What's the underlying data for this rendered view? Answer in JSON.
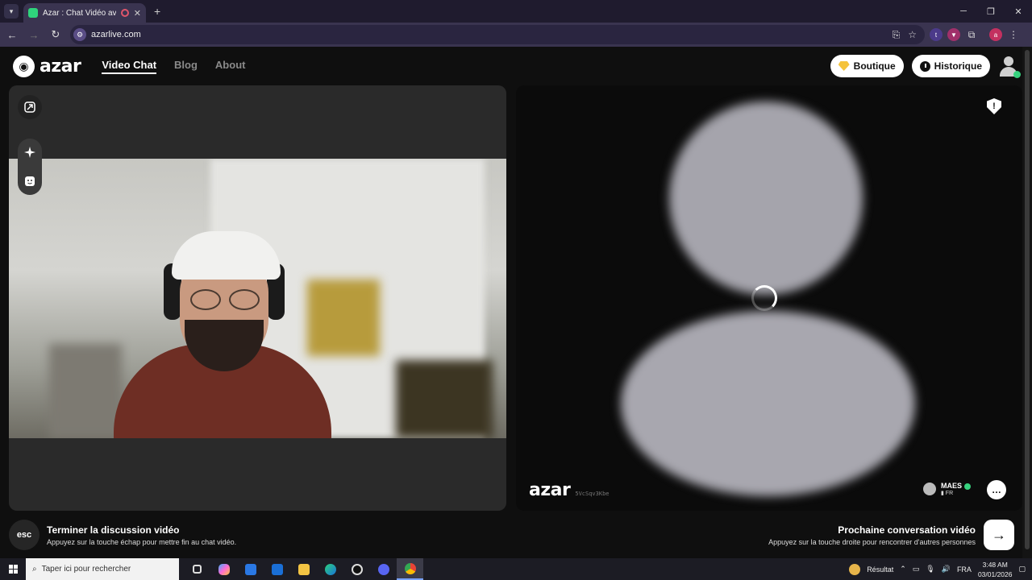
{
  "browser": {
    "tab_title": "Azar : Chat Vidéo avec de n",
    "url": "azarlive.com"
  },
  "nav": {
    "logo_text": "azar",
    "links": [
      "Video Chat",
      "Blog",
      "About"
    ],
    "boutique": "Boutique",
    "historique": "Historique"
  },
  "remote": {
    "watermark": "azar",
    "code": "5VcSqv3Kbe",
    "peer_name": "MAES",
    "peer_country": "FR"
  },
  "bottom": {
    "esc_label": "esc",
    "end_title": "Terminer la discussion vidéo",
    "end_sub": "Appuyez sur la touche échap pour mettre fin au chat vidéo.",
    "next_title": "Prochaine conversation vidéo",
    "next_sub": "Appuyez sur la touche droite pour rencontrer d'autres personnes"
  },
  "taskbar": {
    "search_placeholder": "Taper ici pour rechercher",
    "weather": "Résultat",
    "lang": "FRA",
    "time": "3:48 AM",
    "date": "03/01/2026"
  },
  "colors": {
    "accent_green": "#37d27e",
    "gem": "#f5c33b"
  }
}
